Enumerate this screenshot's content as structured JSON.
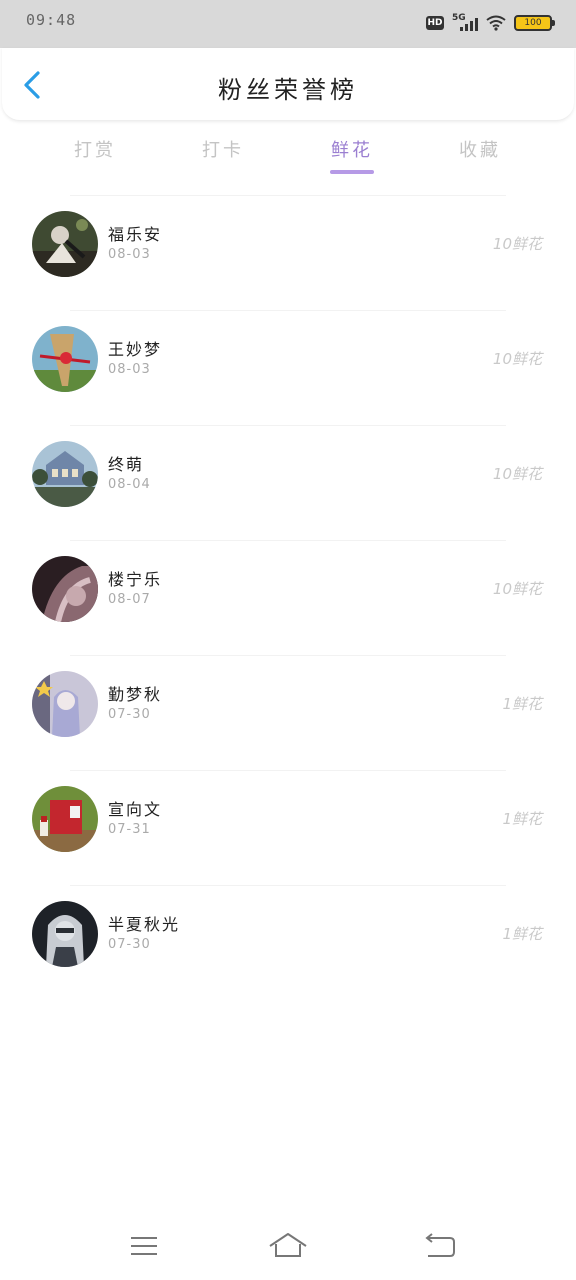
{
  "status_bar": {
    "time": "09:48",
    "hd": "HD",
    "network": "5G",
    "battery": "100"
  },
  "header": {
    "title": "粉丝荣誉榜",
    "back_icon": "chevron-left-icon"
  },
  "tabs": [
    {
      "label": "打赏",
      "active": false
    },
    {
      "label": "打卡",
      "active": false
    },
    {
      "label": "鲜花",
      "active": true
    },
    {
      "label": "收藏",
      "active": false
    }
  ],
  "accent_color": "#9b7fd1",
  "fans": [
    {
      "name": "福乐安",
      "date": "08-03",
      "amount": "10鲜花"
    },
    {
      "name": "王妙梦",
      "date": "08-03",
      "amount": "10鲜花"
    },
    {
      "name": "终萌",
      "date": "08-04",
      "amount": "10鲜花"
    },
    {
      "name": "楼宁乐",
      "date": "08-07",
      "amount": "10鲜花"
    },
    {
      "name": "勤梦秋",
      "date": "07-30",
      "amount": "1鲜花"
    },
    {
      "name": "宣向文",
      "date": "07-31",
      "amount": "1鲜花"
    },
    {
      "name": "半夏秋光",
      "date": "07-30",
      "amount": "1鲜花"
    }
  ],
  "nav_bar": {
    "menu_icon": "menu-icon",
    "home_icon": "home-icon",
    "back_icon": "back-icon"
  }
}
